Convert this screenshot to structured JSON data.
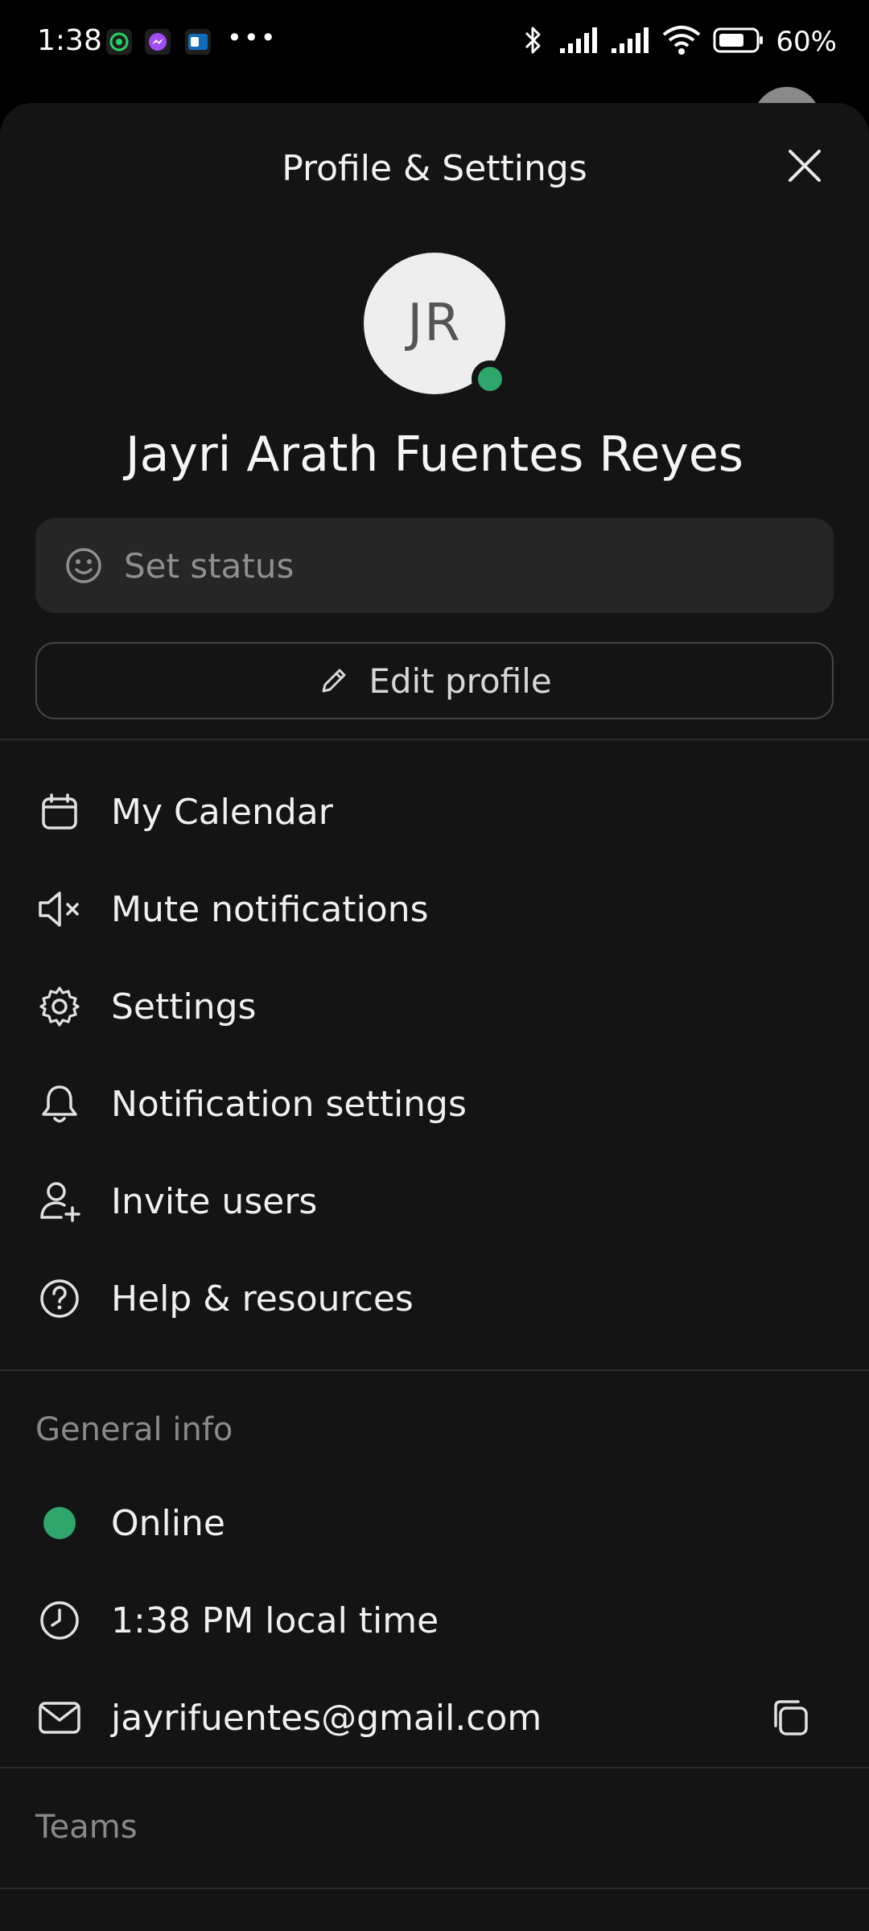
{
  "status_bar": {
    "time": "1:38",
    "battery": "60%",
    "more": "•••",
    "app_icons": [
      "whatsapp-icon",
      "messenger-icon",
      "outlook-icon"
    ],
    "colors": {
      "whatsapp": "#25D366",
      "messenger": "#A04DF5",
      "outlook": "#0F6CBD"
    }
  },
  "sheet": {
    "title": "Profile & Settings",
    "avatar_initials": "JR",
    "user_name": "Jayri Arath Fuentes Reyes",
    "status_placeholder": "Set status",
    "edit_profile": "Edit profile"
  },
  "menu": [
    {
      "icon": "calendar-icon",
      "label": "My Calendar"
    },
    {
      "icon": "speaker-muted-icon",
      "label": "Mute notifications"
    },
    {
      "icon": "gear-icon",
      "label": "Settings"
    },
    {
      "icon": "bell-icon",
      "label": "Notification settings"
    },
    {
      "icon": "person-add-icon",
      "label": "Invite users"
    },
    {
      "icon": "help-icon",
      "label": "Help & resources"
    }
  ],
  "general_info": {
    "title": "General info",
    "presence": "Online",
    "local_time": "1:38 PM local time",
    "email": "jayrifuentes@gmail.com"
  },
  "teams": {
    "title": "Teams"
  },
  "colors": {
    "background": "#141414",
    "presence_green": "#2fa66a",
    "status_box": "#262626"
  }
}
